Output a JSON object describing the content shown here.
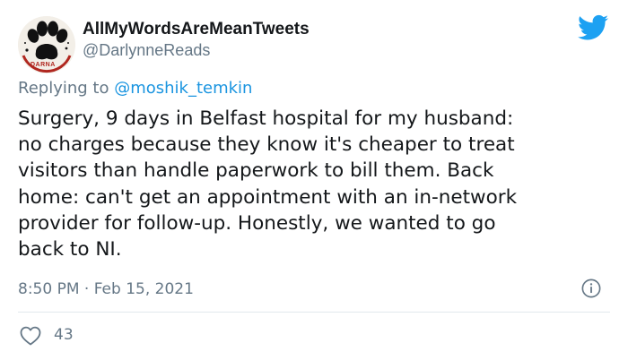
{
  "author": {
    "display_name": "AllMyWordsAreMeanTweets",
    "handle": "@DarlynneReads",
    "avatar_text": "DARNA"
  },
  "reply": {
    "prefix": "Replying to ",
    "mention": "@moshik_temkin"
  },
  "body": "Surgery, 9 days in Belfast hospital for my husband:\nno charges because they know it's cheaper to treat\nvisitors than handle paperwork to bill them. Back\nhome: can't get an appointment with an in-network\nprovider for follow-up. Honestly, we wanted to go\nback to NI.",
  "meta": {
    "timestamp": "8:50 PM · Feb 15, 2021"
  },
  "actions": {
    "likes": "43"
  },
  "colors": {
    "twitter_blue": "#1da1f2",
    "mention_blue": "#1b95e0",
    "muted": "#657786",
    "divider": "#e1e8ed"
  },
  "icons": [
    "twitter-bird-icon",
    "info-icon",
    "heart-icon",
    "paw-print-icon"
  ]
}
